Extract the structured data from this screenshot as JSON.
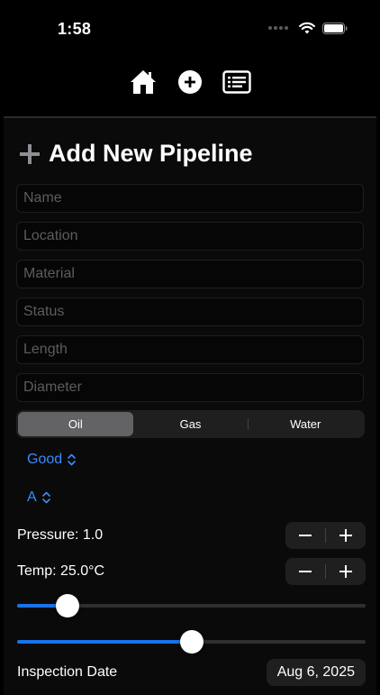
{
  "status_bar": {
    "time": "1:58"
  },
  "nav": {
    "items": [
      {
        "name": "home",
        "icon": "house-icon"
      },
      {
        "name": "add",
        "icon": "plus-circle-icon"
      },
      {
        "name": "list",
        "icon": "list-icon"
      }
    ]
  },
  "form": {
    "title": "Add New Pipeline",
    "fields": [
      {
        "key": "name",
        "placeholder": "Name",
        "value": ""
      },
      {
        "key": "location",
        "placeholder": "Location",
        "value": ""
      },
      {
        "key": "material",
        "placeholder": "Material",
        "value": ""
      },
      {
        "key": "status",
        "placeholder": "Status",
        "value": ""
      },
      {
        "key": "length",
        "placeholder": "Length",
        "value": ""
      },
      {
        "key": "diameter",
        "placeholder": "Diameter",
        "value": ""
      }
    ],
    "segments": {
      "options": [
        "Oil",
        "Gas",
        "Water"
      ],
      "selected": "Oil"
    },
    "condition_picker": "Good",
    "grade_picker": "A",
    "pressure_label": "Pressure: 1.0",
    "temp_label": "Temp: 25.0°C",
    "slider1_value": 0.12,
    "slider2_value": 0.5,
    "inspection_label": "Inspection Date",
    "inspection_date": "Aug 6, 2025"
  },
  "colors": {
    "accent": "#3d8bff",
    "slider_fill": "#1a73e8",
    "background": "#000000"
  }
}
